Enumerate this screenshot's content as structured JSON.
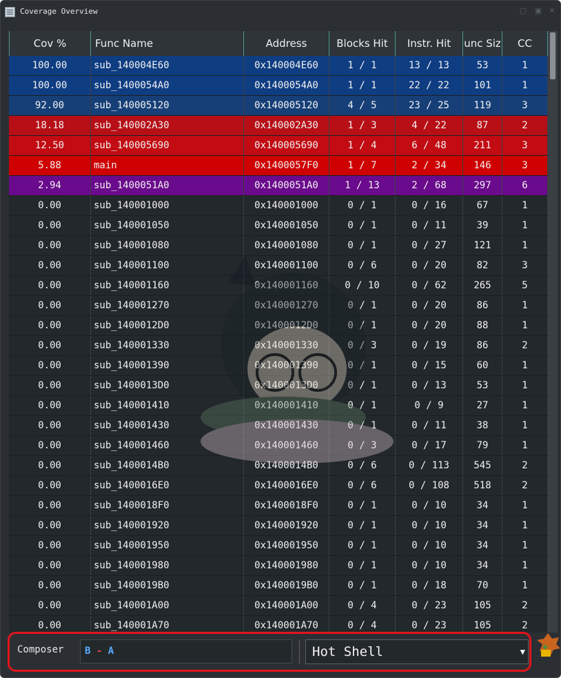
{
  "window": {
    "title": "Coverage Overview"
  },
  "columns": [
    "Cov %",
    "Func Name",
    "Address",
    "Blocks Hit",
    "Instr. Hit",
    "unc Siz",
    "CC"
  ],
  "colors": {
    "full": "#0f3d82",
    "high": "#163f78",
    "low": "#b80f17",
    "lowest": "#cf0000",
    "minimal": "#6a0a8c",
    "none": "#22282b",
    "accent": "#4a9a93",
    "highlight": "#e2141b"
  },
  "rows": [
    {
      "cov": "100.00",
      "name": "sub_140004E60",
      "addr": "0x140004E60",
      "blocks": "1 / 1",
      "instr": "13 / 13",
      "size": "53",
      "cc": "1",
      "bg": "#0f3d82"
    },
    {
      "cov": "100.00",
      "name": "sub_1400054A0",
      "addr": "0x1400054A0",
      "blocks": "1 / 1",
      "instr": "22 / 22",
      "size": "101",
      "cc": "1",
      "bg": "#0f3d82"
    },
    {
      "cov": "92.00",
      "name": "sub_140005120",
      "addr": "0x140005120",
      "blocks": "4 / 5",
      "instr": "23 / 25",
      "size": "119",
      "cc": "3",
      "bg": "#163f78"
    },
    {
      "cov": "18.18",
      "name": "sub_140002A30",
      "addr": "0x140002A30",
      "blocks": "1 / 3",
      "instr": "4 / 22",
      "size": "87",
      "cc": "2",
      "bg": "#b80f17"
    },
    {
      "cov": "12.50",
      "name": "sub_140005690",
      "addr": "0x140005690",
      "blocks": "1 / 4",
      "instr": "6 / 48",
      "size": "211",
      "cc": "3",
      "bg": "#c20b12"
    },
    {
      "cov": "5.88",
      "name": "main",
      "addr": "0x1400057F0",
      "blocks": "1 / 7",
      "instr": "2 / 34",
      "size": "146",
      "cc": "3",
      "bg": "#cf0000"
    },
    {
      "cov": "2.94",
      "name": "sub_1400051A0",
      "addr": "0x1400051A0",
      "blocks": "1 / 13",
      "instr": "2 / 68",
      "size": "297",
      "cc": "6",
      "bg": "#6a0a8c"
    },
    {
      "cov": "0.00",
      "name": "sub_140001000",
      "addr": "0x140001000",
      "blocks": "0 / 1",
      "instr": "0 / 16",
      "size": "67",
      "cc": "1",
      "bg": "#22282b"
    },
    {
      "cov": "0.00",
      "name": "sub_140001050",
      "addr": "0x140001050",
      "blocks": "0 / 1",
      "instr": "0 / 11",
      "size": "39",
      "cc": "1",
      "bg": "#22282b"
    },
    {
      "cov": "0.00",
      "name": "sub_140001080",
      "addr": "0x140001080",
      "blocks": "0 / 1",
      "instr": "0 / 27",
      "size": "121",
      "cc": "1",
      "bg": "#22282b"
    },
    {
      "cov": "0.00",
      "name": "sub_140001100",
      "addr": "0x140001100",
      "blocks": "0 / 6",
      "instr": "0 / 20",
      "size": "82",
      "cc": "3",
      "bg": "#22282b"
    },
    {
      "cov": "0.00",
      "name": "sub_140001160",
      "addr": "0x140001160",
      "blocks": "0 / 10",
      "instr": "0 / 62",
      "size": "265",
      "cc": "5",
      "bg": "#22282b"
    },
    {
      "cov": "0.00",
      "name": "sub_140001270",
      "addr": "0x140001270",
      "blocks": "0 / 1",
      "instr": "0 / 20",
      "size": "86",
      "cc": "1",
      "bg": "#22282b"
    },
    {
      "cov": "0.00",
      "name": "sub_1400012D0",
      "addr": "0x1400012D0",
      "blocks": "0 / 1",
      "instr": "0 / 20",
      "size": "88",
      "cc": "1",
      "bg": "#22282b"
    },
    {
      "cov": "0.00",
      "name": "sub_140001330",
      "addr": "0x140001330",
      "blocks": "0 / 3",
      "instr": "0 / 19",
      "size": "86",
      "cc": "2",
      "bg": "#22282b"
    },
    {
      "cov": "0.00",
      "name": "sub_140001390",
      "addr": "0x140001390",
      "blocks": "0 / 1",
      "instr": "0 / 15",
      "size": "60",
      "cc": "1",
      "bg": "#22282b"
    },
    {
      "cov": "0.00",
      "name": "sub_1400013D0",
      "addr": "0x1400013D0",
      "blocks": "0 / 1",
      "instr": "0 / 13",
      "size": "53",
      "cc": "1",
      "bg": "#22282b"
    },
    {
      "cov": "0.00",
      "name": "sub_140001410",
      "addr": "0x140001410",
      "blocks": "0 / 1",
      "instr": "0 / 9",
      "size": "27",
      "cc": "1",
      "bg": "#22282b"
    },
    {
      "cov": "0.00",
      "name": "sub_140001430",
      "addr": "0x140001430",
      "blocks": "0 / 1",
      "instr": "0 / 11",
      "size": "38",
      "cc": "1",
      "bg": "#22282b"
    },
    {
      "cov": "0.00",
      "name": "sub_140001460",
      "addr": "0x140001460",
      "blocks": "0 / 3",
      "instr": "0 / 17",
      "size": "79",
      "cc": "1",
      "bg": "#22282b"
    },
    {
      "cov": "0.00",
      "name": "sub_1400014B0",
      "addr": "0x1400014B0",
      "blocks": "0 / 6",
      "instr": "0 / 113",
      "size": "545",
      "cc": "2",
      "bg": "#22282b"
    },
    {
      "cov": "0.00",
      "name": "sub_1400016E0",
      "addr": "0x1400016E0",
      "blocks": "0 / 6",
      "instr": "0 / 108",
      "size": "518",
      "cc": "2",
      "bg": "#22282b"
    },
    {
      "cov": "0.00",
      "name": "sub_1400018F0",
      "addr": "0x1400018F0",
      "blocks": "0 / 1",
      "instr": "0 / 10",
      "size": "34",
      "cc": "1",
      "bg": "#22282b"
    },
    {
      "cov": "0.00",
      "name": "sub_140001920",
      "addr": "0x140001920",
      "blocks": "0 / 1",
      "instr": "0 / 10",
      "size": "34",
      "cc": "1",
      "bg": "#22282b"
    },
    {
      "cov": "0.00",
      "name": "sub_140001950",
      "addr": "0x140001950",
      "blocks": "0 / 1",
      "instr": "0 / 10",
      "size": "34",
      "cc": "1",
      "bg": "#22282b"
    },
    {
      "cov": "0.00",
      "name": "sub_140001980",
      "addr": "0x140001980",
      "blocks": "0 / 1",
      "instr": "0 / 10",
      "size": "34",
      "cc": "1",
      "bg": "#22282b"
    },
    {
      "cov": "0.00",
      "name": "sub_1400019B0",
      "addr": "0x1400019B0",
      "blocks": "0 / 1",
      "instr": "0 / 18",
      "size": "70",
      "cc": "1",
      "bg": "#22282b"
    },
    {
      "cov": "0.00",
      "name": "sub_140001A00",
      "addr": "0x140001A00",
      "blocks": "0 / 4",
      "instr": "0 / 23",
      "size": "105",
      "cc": "2",
      "bg": "#22282b"
    },
    {
      "cov": "0.00",
      "name": "sub_140001A70",
      "addr": "0x140001A70",
      "blocks": "0 / 4",
      "instr": "0 / 23",
      "size": "105",
      "cc": "2",
      "bg": "#22282b"
    }
  ],
  "composer": {
    "label": "Composer",
    "expr_left": "B",
    "expr_op": "-",
    "expr_right": "A",
    "shell_value": "Hot Shell"
  }
}
